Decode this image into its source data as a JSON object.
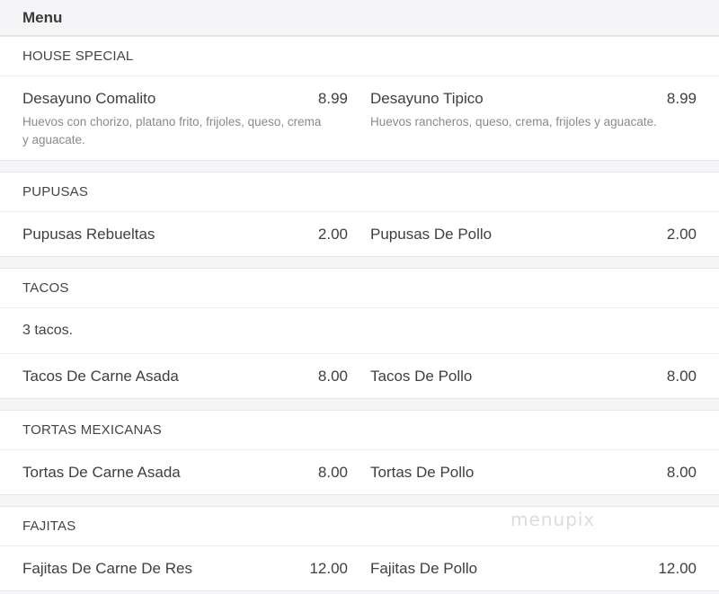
{
  "header": {
    "title": "Menu"
  },
  "sections": [
    {
      "title": "HOUSE SPECIAL",
      "items": [
        {
          "name": "Desayuno Comalito",
          "price": "8.99",
          "description": "Huevos con chorizo, platano frito, frijoles, queso, crema y aguacate."
        },
        {
          "name": "Desayuno Tipico",
          "price": "8.99",
          "description": "Huevos rancheros, queso, crema, frijoles y aguacate."
        }
      ]
    },
    {
      "title": "PUPUSAS",
      "items": [
        {
          "name": "Pupusas Rebueltas",
          "price": "2.00"
        },
        {
          "name": "Pupusas De Pollo",
          "price": "2.00"
        }
      ]
    },
    {
      "title": "TACOS",
      "note": "3 tacos.",
      "items": [
        {
          "name": "Tacos De Carne Asada",
          "price": "8.00"
        },
        {
          "name": "Tacos De Pollo",
          "price": "8.00"
        }
      ]
    },
    {
      "title": "TORTAS MEXICANAS",
      "items": [
        {
          "name": "Tortas De Carne Asada",
          "price": "8.00"
        },
        {
          "name": "Tortas De Pollo",
          "price": "8.00"
        }
      ]
    },
    {
      "title": "FAJITAS",
      "items": [
        {
          "name": "Fajitas De Carne De Res",
          "price": "12.00"
        },
        {
          "name": "Fajitas De Pollo",
          "price": "12.00"
        }
      ]
    }
  ],
  "watermark": "menupix"
}
